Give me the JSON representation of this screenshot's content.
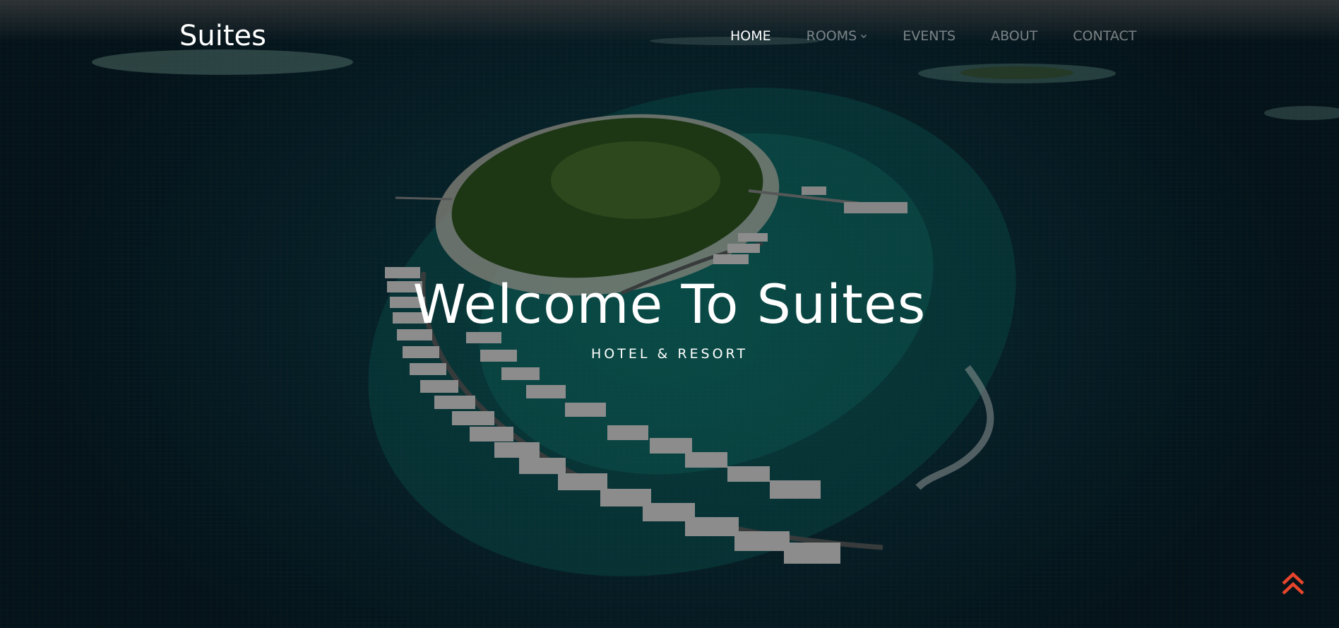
{
  "brand": {
    "name": "Suites"
  },
  "nav": {
    "items": [
      {
        "label": "HOME",
        "active": true
      },
      {
        "label": "ROOMS",
        "has_dropdown": true
      },
      {
        "label": "EVENTS"
      },
      {
        "label": "ABOUT"
      },
      {
        "label": "CONTACT"
      }
    ]
  },
  "hero": {
    "title": "Welcome To Suites",
    "subtitle": "HOTEL & RESORT"
  },
  "icons": {
    "back_to_top": "double-chevron-up-icon",
    "dropdown": "chevron-down-icon"
  },
  "colors": {
    "accent": "#e8452c",
    "nav_active": "#ffffff",
    "nav_inactive": "#8a9296"
  }
}
